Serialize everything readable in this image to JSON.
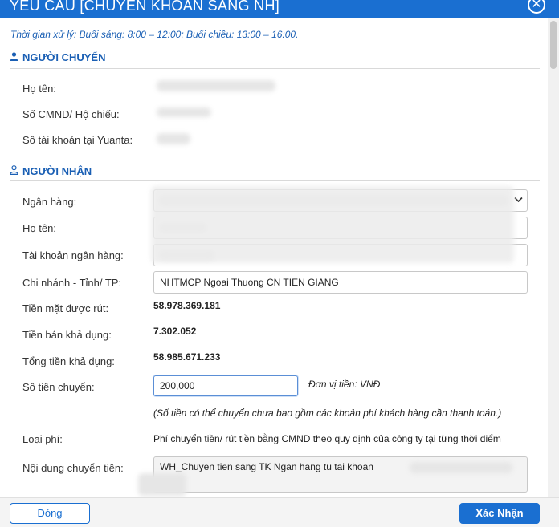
{
  "dialog": {
    "title": "YÊU CẦU [CHUYỂN KHOẢN SANG NH]",
    "close_icon": "close-icon",
    "note": "Thời gian xử lý: Buổi sáng: 8:00 – 12:00; Buổi chiều: 13:00 – 16:00."
  },
  "sender": {
    "heading": "NGƯỜI CHUYỂN",
    "icon": "user-icon",
    "labels": {
      "name": "Họ tên:",
      "id": "Số CMND/ Hộ chiếu:",
      "account": "Số tài khoản tại Yuanta:"
    }
  },
  "receiver": {
    "heading": "NGƯỜI NHẬN",
    "icon": "user-outline-icon",
    "labels": {
      "bank": "Ngân hàng:",
      "name": "Họ tên:",
      "account": "Tài khoản ngân hàng:",
      "branch": "Chi nhánh - Tỉnh/ TP:",
      "cash_withdrawable": "Tiền mặt được rút:",
      "sale_available": "Tiền bán khả dụng:",
      "total_available": "Tổng tiền khả dụng:",
      "amount": "Số tiền chuyển:",
      "fee_type": "Loại phí:",
      "content": "Nội dung chuyển tiền:"
    },
    "branch_value": "NHTMCP Ngoai Thuong CN TIEN GIANG",
    "cash_withdrawable": "58.978.369.181",
    "sale_available": "7.302.052",
    "total_available": "58.985.671.233",
    "amount_value": "200,000",
    "unit": "Đơn vị tiền: VNĐ",
    "unit_note": "(Số tiền có thể chuyển chưa bao gồm các khoản phí khách hàng cần thanh toán.)",
    "fee_text": "Phí chuyển tiền/ rút tiền bằng CMND theo quy định của công ty tại từng thời điểm",
    "content_value": "WH_Chuyen tien sang TK Ngan hang tu tai khoan"
  },
  "footer": {
    "close_label": "Đóng",
    "confirm_label": "Xác Nhận"
  },
  "colors": {
    "primary": "#1a6fd1",
    "heading": "#1a5fb4"
  }
}
